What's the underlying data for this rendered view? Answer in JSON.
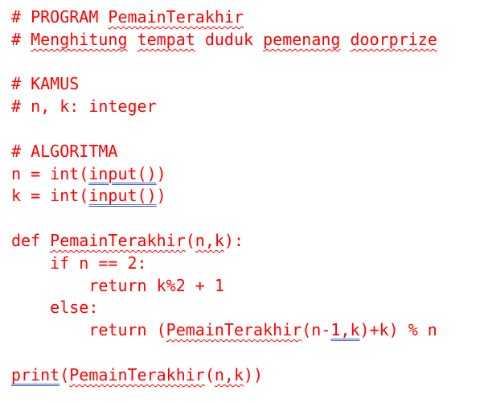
{
  "document": {
    "lines": [
      {
        "indent": "",
        "segments": [
          {
            "t": "# PROGRAM "
          },
          {
            "t": "PemainTerakhir",
            "mark": "sp"
          }
        ]
      },
      {
        "indent": "",
        "segments": [
          {
            "t": "# "
          },
          {
            "t": "Menghitung",
            "mark": "sp"
          },
          {
            "t": " "
          },
          {
            "t": "tempat",
            "mark": "sp"
          },
          {
            "t": " duduk "
          },
          {
            "t": "pemenang",
            "mark": "sp"
          },
          {
            "t": " "
          },
          {
            "t": "doorprize",
            "mark": "sp"
          }
        ]
      },
      {
        "indent": "",
        "segments": []
      },
      {
        "indent": "",
        "segments": [
          {
            "t": "# KAMUS"
          }
        ]
      },
      {
        "indent": "",
        "segments": [
          {
            "t": "# n, k: integer"
          }
        ]
      },
      {
        "indent": "",
        "segments": []
      },
      {
        "indent": "",
        "segments": [
          {
            "t": "# ALGORITMA"
          }
        ]
      },
      {
        "indent": "",
        "segments": [
          {
            "t": "n = int("
          },
          {
            "t": "input()",
            "mark": "gr"
          },
          {
            "t": ")"
          }
        ]
      },
      {
        "indent": "",
        "segments": [
          {
            "t": "k = int("
          },
          {
            "t": "input()",
            "mark": "gr"
          },
          {
            "t": ")"
          }
        ]
      },
      {
        "indent": "",
        "segments": []
      },
      {
        "indent": "",
        "segments": [
          {
            "t": "def "
          },
          {
            "t": "PemainTerakhir",
            "mark": "sp"
          },
          {
            "t": "("
          },
          {
            "t": "n,k",
            "mark": "sp"
          },
          {
            "t": "):"
          }
        ]
      },
      {
        "indent": "    ",
        "segments": [
          {
            "t": "if n == 2:"
          }
        ]
      },
      {
        "indent": "        ",
        "segments": [
          {
            "t": "return k%2 + 1"
          }
        ]
      },
      {
        "indent": "    ",
        "segments": [
          {
            "t": "else:"
          }
        ]
      },
      {
        "indent": "        ",
        "segments": [
          {
            "t": "return ("
          },
          {
            "t": "PemainTerakhir",
            "mark": "sp"
          },
          {
            "t": "(n-"
          },
          {
            "t": "1,k",
            "mark": "gr"
          },
          {
            "t": ")+k) % n"
          }
        ]
      },
      {
        "indent": "",
        "segments": []
      },
      {
        "indent": "",
        "segments": [
          {
            "t": "print",
            "mark": "gr"
          },
          {
            "t": "("
          },
          {
            "t": "PemainTerakhir",
            "mark": "sp"
          },
          {
            "t": "("
          },
          {
            "t": "n,k",
            "mark": "sp"
          },
          {
            "t": "))"
          }
        ]
      }
    ]
  },
  "colors": {
    "text": "#ff0000",
    "spelling_underline": "#ff0000",
    "grammar_underline": "#3a5fcd",
    "background": "#ffffff"
  }
}
